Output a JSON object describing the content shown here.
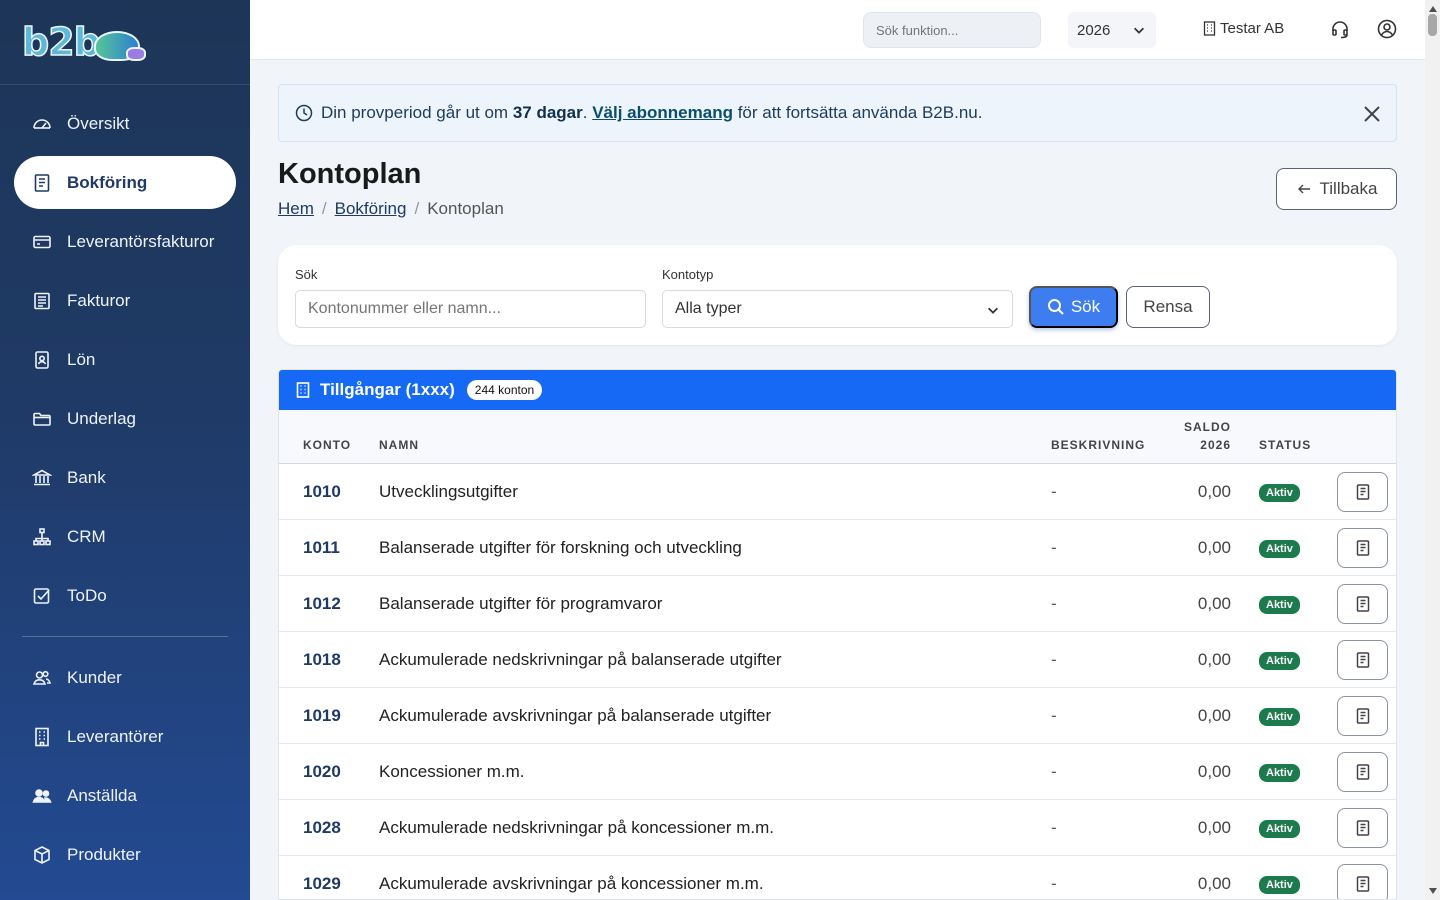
{
  "sidebar": {
    "brand": "b2b",
    "items": [
      {
        "label": "Översikt",
        "icon": "speedometer-icon",
        "active": false
      },
      {
        "label": "Bokföring",
        "icon": "journal-icon",
        "active": true
      },
      {
        "label": "Leverantörsfakturor",
        "icon": "credit-card-icon",
        "active": false
      },
      {
        "label": "Fakturor",
        "icon": "invoice-icon",
        "active": false
      },
      {
        "label": "Lön",
        "icon": "id-badge-icon",
        "active": false
      },
      {
        "label": "Underlag",
        "icon": "folder-icon",
        "active": false
      },
      {
        "label": "Bank",
        "icon": "bank-icon",
        "active": false
      },
      {
        "label": "CRM",
        "icon": "diagram-icon",
        "active": false
      },
      {
        "label": "ToDo",
        "icon": "checkbox-icon",
        "active": false
      }
    ],
    "items2": [
      {
        "label": "Kunder",
        "icon": "people-icon"
      },
      {
        "label": "Leverantörer",
        "icon": "building-icon"
      },
      {
        "label": "Anställda",
        "icon": "people-fill-icon"
      },
      {
        "label": "Produkter",
        "icon": "box-icon"
      }
    ]
  },
  "topbar": {
    "search_placeholder": "Sök funktion...",
    "year": "2026",
    "company": "Testar AB",
    "support_icon": "headset-icon",
    "profile_icon": "person-circle-icon"
  },
  "banner": {
    "text_before": "Din provperiod går ut om ",
    "days": "37 dagar",
    "text_mid": ". ",
    "link": "Välj abonnemang",
    "text_after": " för att fortsätta använda B2B.nu."
  },
  "page": {
    "title": "Kontoplan",
    "breadcrumb": {
      "home": "Hem",
      "parent": "Bokföring",
      "current": "Kontoplan",
      "sep": "/"
    },
    "back_label": "Tillbaka"
  },
  "filters": {
    "search_label": "Sök",
    "search_placeholder": "Kontonummer eller namn...",
    "type_label": "Kontotyp",
    "type_value": "Alla typer",
    "search_button": "Sök",
    "clear_button": "Rensa"
  },
  "group": {
    "title": "Tillgångar (1xxx)",
    "count": "244 konton"
  },
  "table": {
    "headers": {
      "konto": "KONTO",
      "namn": "NAMN",
      "beskrivning": "BESKRIVNING",
      "saldo_line1": "SALDO",
      "saldo_line2": "2026",
      "status": "STATUS"
    },
    "rows": [
      {
        "konto": "1010",
        "namn": "Utvecklingsutgifter",
        "beskrivning": "-",
        "saldo": "0,00",
        "status": "Aktiv"
      },
      {
        "konto": "1011",
        "namn": "Balanserade utgifter för forskning och utveckling",
        "beskrivning": "-",
        "saldo": "0,00",
        "status": "Aktiv"
      },
      {
        "konto": "1012",
        "namn": "Balanserade utgifter för programvaror",
        "beskrivning": "-",
        "saldo": "0,00",
        "status": "Aktiv"
      },
      {
        "konto": "1018",
        "namn": "Ackumulerade nedskrivningar på balanserade utgifter",
        "beskrivning": "-",
        "saldo": "0,00",
        "status": "Aktiv"
      },
      {
        "konto": "1019",
        "namn": "Ackumulerade avskrivningar på balanserade utgifter",
        "beskrivning": "-",
        "saldo": "0,00",
        "status": "Aktiv"
      },
      {
        "konto": "1020",
        "namn": "Koncessioner m.m.",
        "beskrivning": "-",
        "saldo": "0,00",
        "status": "Aktiv"
      },
      {
        "konto": "1028",
        "namn": "Ackumulerade nedskrivningar på koncessioner m.m.",
        "beskrivning": "-",
        "saldo": "0,00",
        "status": "Aktiv"
      },
      {
        "konto": "1029",
        "namn": "Ackumulerade avskrivningar på koncessioner m.m.",
        "beskrivning": "-",
        "saldo": "0,00",
        "status": "Aktiv"
      }
    ]
  },
  "colors": {
    "sidebar": "#1d3557",
    "accent": "#1669f5",
    "primary_button": "#3d7df0",
    "status_active": "#1c7a4c"
  }
}
